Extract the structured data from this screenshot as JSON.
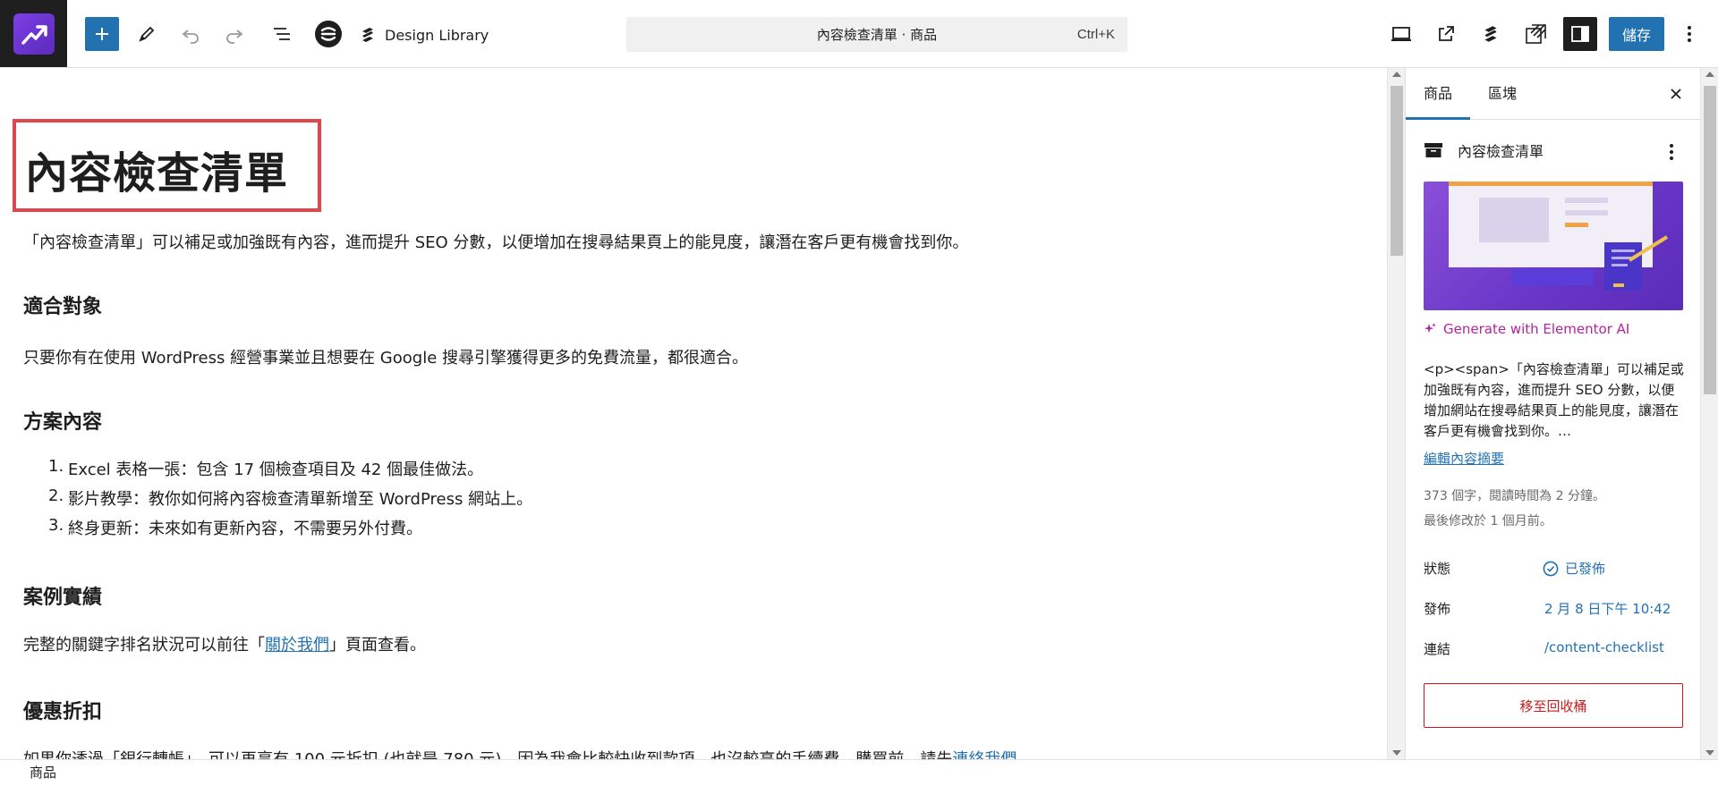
{
  "toolbar": {
    "design_library_label": "Design Library",
    "command_title": "內容檢查清單 · 商品",
    "command_shortcut": "Ctrl+K",
    "save_label": "儲存"
  },
  "content": {
    "title": "內容檢查清單",
    "intro": "「內容檢查清單」可以補足或加強既有內容，進而提升 SEO 分數，以便增加在搜尋結果頁上的能見度，讓潛在客戶更有機會找到你。",
    "sections": [
      {
        "heading": "適合對象",
        "text": "只要你有在使用 WordPress 經營事業並且想要在 Google 搜尋引擎獲得更多的免費流量，都很適合。"
      },
      {
        "heading": "方案內容"
      },
      {
        "heading": "案例實績",
        "text_before": "完整的關鍵字排名狀況可以前往「",
        "link": "關於我們",
        "text_after": "」頁面查看。"
      },
      {
        "heading": "優惠折扣",
        "text": "如果你透過「銀行轉帳」，可以再享有 100 元折扣 (也就是 780 元)，因為我會比較快收到款項，也沒較高的手續費。購買前，請先",
        "link": "連絡我們",
        "tail": "。"
      }
    ],
    "list": [
      {
        "num": "1.",
        "text": "Excel 表格一張：包含 17 個檢查項目及 42 個最佳做法。"
      },
      {
        "num": "2.",
        "text": "影片教學：教你如何將內容檢查清單新增至 WordPress 網站上。"
      },
      {
        "num": "3.",
        "text": "終身更新：未來如有更新內容，不需要另外付費。"
      }
    ]
  },
  "sidebar": {
    "tabs": [
      "商品",
      "區塊"
    ],
    "post_title": "內容檢查清單",
    "ai_label": "Generate with Elementor AI",
    "excerpt": "<p><span>「內容檢查清單」可以補足或加強既有內容，進而提升 SEO 分數，以便增加網站在搜尋結果頁上的能見度，讓潛在客戶更有機會找到你。…",
    "edit_excerpt": "編輯內容摘要",
    "word_count": "373 個字，閱讀時間為 2 分鐘。",
    "modified": "最後修改於 1 個月前。",
    "status_label": "狀態",
    "status_value": "已發佈",
    "publish_label": "發佈",
    "publish_value": "2 月 8 日下午 10:42",
    "link_label": "連結",
    "link_value": "/content-checklist",
    "trash_label": "移至回收桶"
  },
  "statusbar": {
    "breadcrumb": "商品"
  },
  "colors": {
    "accent": "#2271b1",
    "danger": "#cc1818",
    "ai": "#b5239f",
    "highlight_border": "#e0474c"
  }
}
